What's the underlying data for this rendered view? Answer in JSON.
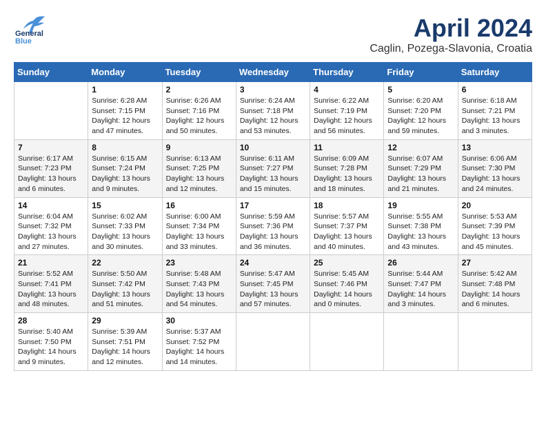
{
  "header": {
    "logo_line1": "General",
    "logo_line2": "Blue",
    "title": "April 2024",
    "subtitle": "Caglin, Pozega-Slavonia, Croatia"
  },
  "weekdays": [
    "Sunday",
    "Monday",
    "Tuesday",
    "Wednesday",
    "Thursday",
    "Friday",
    "Saturday"
  ],
  "weeks": [
    [
      {
        "day": "",
        "info": ""
      },
      {
        "day": "1",
        "info": "Sunrise: 6:28 AM\nSunset: 7:15 PM\nDaylight: 12 hours\nand 47 minutes."
      },
      {
        "day": "2",
        "info": "Sunrise: 6:26 AM\nSunset: 7:16 PM\nDaylight: 12 hours\nand 50 minutes."
      },
      {
        "day": "3",
        "info": "Sunrise: 6:24 AM\nSunset: 7:18 PM\nDaylight: 12 hours\nand 53 minutes."
      },
      {
        "day": "4",
        "info": "Sunrise: 6:22 AM\nSunset: 7:19 PM\nDaylight: 12 hours\nand 56 minutes."
      },
      {
        "day": "5",
        "info": "Sunrise: 6:20 AM\nSunset: 7:20 PM\nDaylight: 12 hours\nand 59 minutes."
      },
      {
        "day": "6",
        "info": "Sunrise: 6:18 AM\nSunset: 7:21 PM\nDaylight: 13 hours\nand 3 minutes."
      }
    ],
    [
      {
        "day": "7",
        "info": "Sunrise: 6:17 AM\nSunset: 7:23 PM\nDaylight: 13 hours\nand 6 minutes."
      },
      {
        "day": "8",
        "info": "Sunrise: 6:15 AM\nSunset: 7:24 PM\nDaylight: 13 hours\nand 9 minutes."
      },
      {
        "day": "9",
        "info": "Sunrise: 6:13 AM\nSunset: 7:25 PM\nDaylight: 13 hours\nand 12 minutes."
      },
      {
        "day": "10",
        "info": "Sunrise: 6:11 AM\nSunset: 7:27 PM\nDaylight: 13 hours\nand 15 minutes."
      },
      {
        "day": "11",
        "info": "Sunrise: 6:09 AM\nSunset: 7:28 PM\nDaylight: 13 hours\nand 18 minutes."
      },
      {
        "day": "12",
        "info": "Sunrise: 6:07 AM\nSunset: 7:29 PM\nDaylight: 13 hours\nand 21 minutes."
      },
      {
        "day": "13",
        "info": "Sunrise: 6:06 AM\nSunset: 7:30 PM\nDaylight: 13 hours\nand 24 minutes."
      }
    ],
    [
      {
        "day": "14",
        "info": "Sunrise: 6:04 AM\nSunset: 7:32 PM\nDaylight: 13 hours\nand 27 minutes."
      },
      {
        "day": "15",
        "info": "Sunrise: 6:02 AM\nSunset: 7:33 PM\nDaylight: 13 hours\nand 30 minutes."
      },
      {
        "day": "16",
        "info": "Sunrise: 6:00 AM\nSunset: 7:34 PM\nDaylight: 13 hours\nand 33 minutes."
      },
      {
        "day": "17",
        "info": "Sunrise: 5:59 AM\nSunset: 7:36 PM\nDaylight: 13 hours\nand 36 minutes."
      },
      {
        "day": "18",
        "info": "Sunrise: 5:57 AM\nSunset: 7:37 PM\nDaylight: 13 hours\nand 40 minutes."
      },
      {
        "day": "19",
        "info": "Sunrise: 5:55 AM\nSunset: 7:38 PM\nDaylight: 13 hours\nand 43 minutes."
      },
      {
        "day": "20",
        "info": "Sunrise: 5:53 AM\nSunset: 7:39 PM\nDaylight: 13 hours\nand 45 minutes."
      }
    ],
    [
      {
        "day": "21",
        "info": "Sunrise: 5:52 AM\nSunset: 7:41 PM\nDaylight: 13 hours\nand 48 minutes."
      },
      {
        "day": "22",
        "info": "Sunrise: 5:50 AM\nSunset: 7:42 PM\nDaylight: 13 hours\nand 51 minutes."
      },
      {
        "day": "23",
        "info": "Sunrise: 5:48 AM\nSunset: 7:43 PM\nDaylight: 13 hours\nand 54 minutes."
      },
      {
        "day": "24",
        "info": "Sunrise: 5:47 AM\nSunset: 7:45 PM\nDaylight: 13 hours\nand 57 minutes."
      },
      {
        "day": "25",
        "info": "Sunrise: 5:45 AM\nSunset: 7:46 PM\nDaylight: 14 hours\nand 0 minutes."
      },
      {
        "day": "26",
        "info": "Sunrise: 5:44 AM\nSunset: 7:47 PM\nDaylight: 14 hours\nand 3 minutes."
      },
      {
        "day": "27",
        "info": "Sunrise: 5:42 AM\nSunset: 7:48 PM\nDaylight: 14 hours\nand 6 minutes."
      }
    ],
    [
      {
        "day": "28",
        "info": "Sunrise: 5:40 AM\nSunset: 7:50 PM\nDaylight: 14 hours\nand 9 minutes."
      },
      {
        "day": "29",
        "info": "Sunrise: 5:39 AM\nSunset: 7:51 PM\nDaylight: 14 hours\nand 12 minutes."
      },
      {
        "day": "30",
        "info": "Sunrise: 5:37 AM\nSunset: 7:52 PM\nDaylight: 14 hours\nand 14 minutes."
      },
      {
        "day": "",
        "info": ""
      },
      {
        "day": "",
        "info": ""
      },
      {
        "day": "",
        "info": ""
      },
      {
        "day": "",
        "info": ""
      }
    ]
  ]
}
